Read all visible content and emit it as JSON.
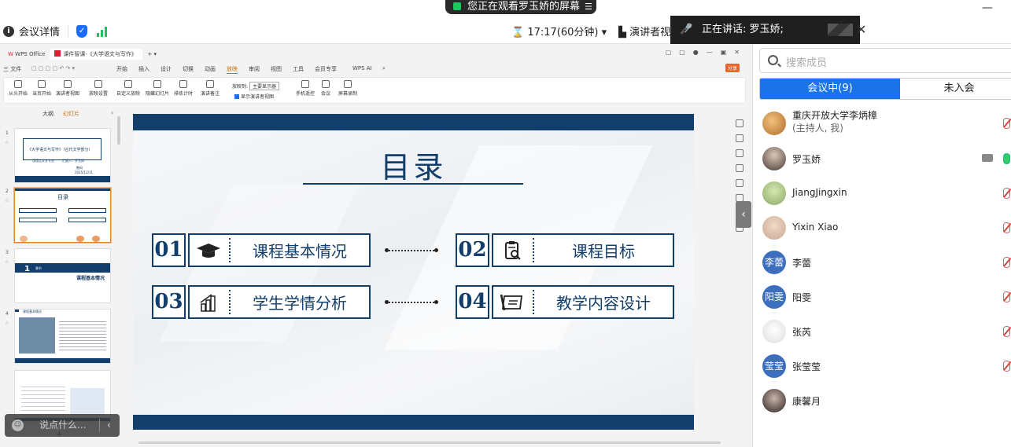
{
  "topbar": {
    "share_banner": "您正在观看罗玉娇的屏幕",
    "meeting_details": "会议详情",
    "timer": "17:17(60分钟)",
    "presenter_view": "演讲者视",
    "speaking_label": "正在讲话:",
    "speaking_name": "罗玉娇;",
    "colors": {
      "accent": "#1a73e8",
      "banner_bg": "#2a2a2a",
      "signal": "#1dbf5e"
    }
  },
  "wps": {
    "app_tab": "WPS Office",
    "doc_tab": "课件智课-《大学语文与写作》",
    "menu": [
      "三 文件",
      "开始",
      "插入",
      "设计",
      "切换",
      "动画",
      "放映",
      "审阅",
      "视图",
      "工具",
      "会员专享",
      "WPS AI"
    ],
    "active_menu": "放映",
    "share_label": "分享",
    "ribbon": {
      "from_start": "从头开始",
      "from_current": "当页开始",
      "presenter_view": "演讲者视图",
      "show_settings": "放映设置",
      "custom_show": "自定义放映",
      "hide_slide": "隐藏幻灯片",
      "rehearse": "排练计时",
      "presenter_notes": "演讲备注",
      "show_on_label": "放映到:",
      "show_on_value": "主要显示器",
      "show_presenter_checkbox": "显示演讲者视图",
      "phone_remote": "手机遥控",
      "meeting": "会议",
      "screen_record": "屏幕录制"
    },
    "view_tabs": [
      "大纲",
      "幻灯片"
    ],
    "thumbnails": {
      "s1_title": "《大学语文与写作》（古代文学部分）",
      "s1_sub": "汉语言文学专业",
      "s1_author": "汇报人：罗玉娇",
      "s1_unit": "数码",
      "s1_date": "2025/12/11",
      "s2_title": "目录",
      "s3_num": "1",
      "s3_small": "章节",
      "s3_title": "课程基本情况",
      "s4_title": "课程基本情况"
    },
    "chat_placeholder": "说点什么..."
  },
  "slide": {
    "title": "目录",
    "items": [
      {
        "num": "01",
        "label": "课程基本情况",
        "icon": "graduation-cap-icon"
      },
      {
        "num": "02",
        "label": "课程目标",
        "icon": "clipboard-search-icon"
      },
      {
        "num": "03",
        "label": "学生学情分析",
        "icon": "bar-chart-icon"
      },
      {
        "num": "04",
        "label": "教学内容设计",
        "icon": "document-pen-icon"
      }
    ],
    "colors": {
      "navy": "#123e6b"
    }
  },
  "panel": {
    "search_placeholder": "搜索成员",
    "tab_in_meeting": "会议中(9)",
    "tab_not_joined": "未入会",
    "members": [
      {
        "name": "重庆开放大学李炳樟",
        "sub": "(主持人, 我)",
        "avatar": "",
        "status": "muted"
      },
      {
        "name": "罗玉娇",
        "avatar": "",
        "status": "speaking"
      },
      {
        "name": "JiangJingxin",
        "avatar": "",
        "status": "muted"
      },
      {
        "name": "Yixin Xiao",
        "avatar": "",
        "status": "muted"
      },
      {
        "name": "李蕾",
        "avatar": "李蕾",
        "status": "muted"
      },
      {
        "name": "阳雯",
        "avatar": "阳雯",
        "status": "muted"
      },
      {
        "name": "张芮",
        "avatar": "",
        "status": "muted"
      },
      {
        "name": "张莹莹",
        "avatar": "莹莹",
        "status": "muted"
      },
      {
        "name": "康馨月",
        "avatar": "",
        "status": "none"
      }
    ]
  }
}
